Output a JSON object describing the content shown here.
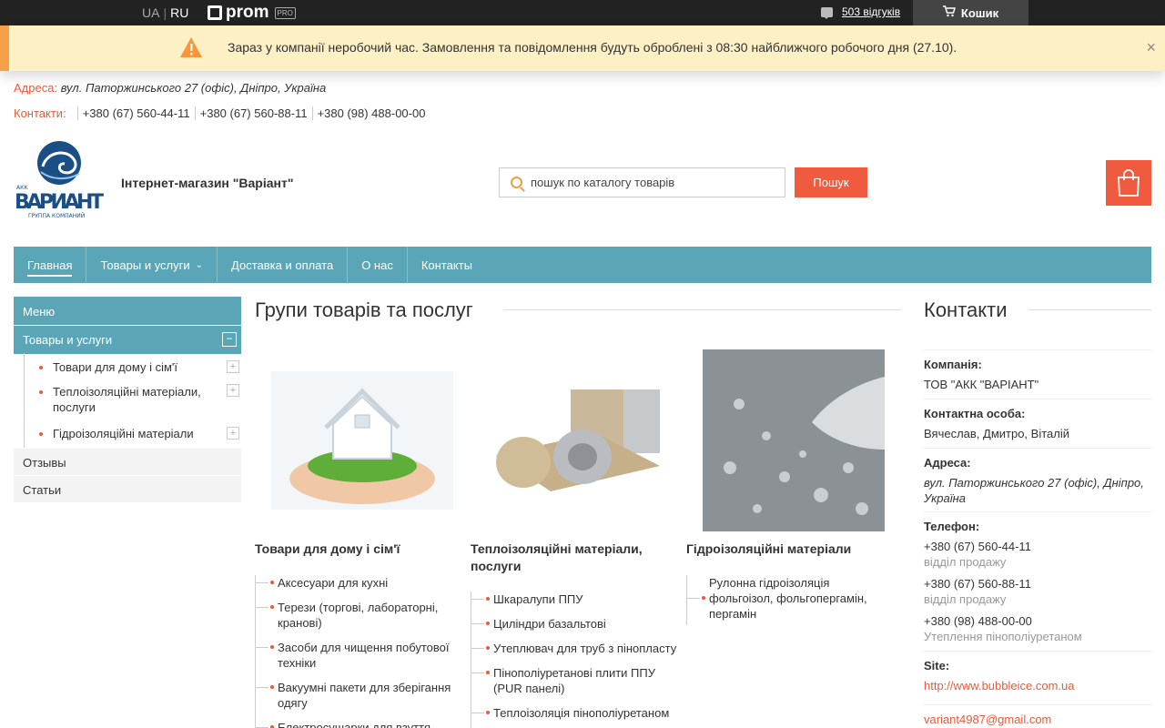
{
  "topbar": {
    "lang_ua": "UA",
    "lang_ru": "RU",
    "prom_label": "prom",
    "pro_badge": "PRO",
    "reviews": "503 відгуків",
    "cart": "Кошик"
  },
  "alert": {
    "message": "Зараз у компанії неробочий час. Замовлення та повідомлення будуть оброблені з 08:30 найближчого робочого дня (27.10).",
    "close": "×"
  },
  "address": {
    "label": "Адреса:",
    "value": "вул. Паторжинського 27 (офіс), Дніпро, Україна"
  },
  "contacts_bar": {
    "label": "Контакти:",
    "phones": [
      "+380 (67) 560-44-11",
      "+380 (67) 560-88-11",
      "+380 (98) 488-00-00"
    ]
  },
  "header": {
    "logo_top": "АКК",
    "logo_text": "ВАРИАНТ",
    "logo_sub": "ГРУППА КОМПАНИЙ",
    "store_name": "Інтернет-магазин \"Варіант\"",
    "search_placeholder": "пошук по каталогу товарів",
    "search_button": "Пошук"
  },
  "nav": {
    "items": [
      "Главная",
      "Товары и услуги",
      "Доставка и оплата",
      "О нас",
      "Контакты"
    ]
  },
  "sidebar": {
    "menu": "Меню",
    "category": "Товары и услуги",
    "minus": "−",
    "plus": "+",
    "subs": [
      "Товари для дому і сім'ї",
      "Теплоізоляційні матеріали, послуги",
      "Гідроізоляційні матеріали"
    ],
    "plain": [
      "Отзывы",
      "Статьи"
    ]
  },
  "center": {
    "title": "Групи товарів та послуг",
    "groups": [
      {
        "title": "Товари для дому і сім'ї",
        "items": [
          "Аксесуари для кухні",
          "Терези (торгові, лабораторні, кранові)",
          "Засоби для чищення побутової техніки",
          "Вакуумні пакети для зберігання одягу",
          "Електросушарки для взуття"
        ]
      },
      {
        "title": "Теплоізоляційні матеріали, послуги",
        "items": [
          "Шкаралупи ППУ",
          "Циліндри базальтові",
          "Утеплювач для труб з пінопласту",
          "Пінополіуретанові плити ППУ (PUR панелі)",
          "Теплоізоляція пінополіуретаном"
        ]
      },
      {
        "title": "Гідроізоляційні матеріали",
        "items": [
          "Рулонна гідроізоляція фольгоізол, фольгопергамін, пергамін"
        ]
      }
    ]
  },
  "contacts": {
    "title": "Контакти",
    "company_label": "Компанія:",
    "company": "ТОВ \"АКК \"ВАРІАНТ\"",
    "person_label": "Контактна особа:",
    "person": "Вячеслав, Дмитро, Віталій",
    "address_label": "Адреса:",
    "address": "вул. Паторжинського 27 (офіс), Дніпро, Україна",
    "phone_label": "Телефон:",
    "phones": [
      {
        "number": "+380 (67) 560-44-11",
        "note": "відділ продажу"
      },
      {
        "number": "+380 (67) 560-88-11",
        "note": "відділ продажу"
      },
      {
        "number": "+380 (98) 488-00-00",
        "note": "Утеплення пінополіуретаном"
      }
    ],
    "site_label": "Site:",
    "site": "http://www.bubbleice.com.ua",
    "email": "variant4987@gmail.com"
  },
  "colors": {
    "accent": "#f05a3e",
    "nav": "#5ba6b6",
    "topbar": "#222222",
    "alert_bg": "#fdf0c4"
  }
}
